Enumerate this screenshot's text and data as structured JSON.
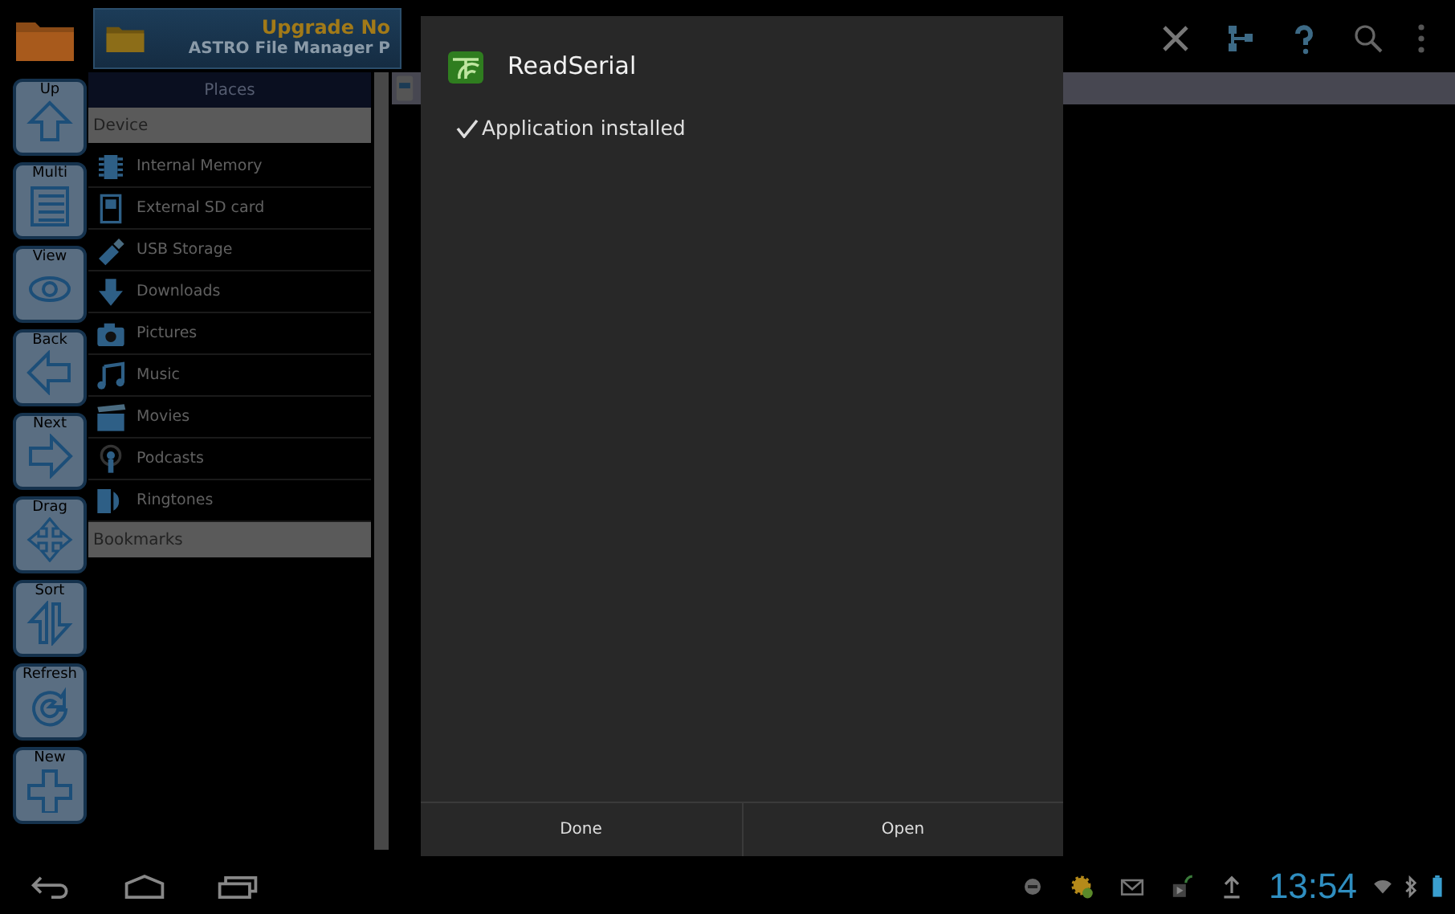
{
  "banner": {
    "headline": "Upgrade No",
    "subtitle": "ASTRO File Manager P"
  },
  "toolbox": [
    {
      "label": "Up",
      "kind": "up"
    },
    {
      "label": "Multi",
      "kind": "multi"
    },
    {
      "label": "View",
      "kind": "view"
    },
    {
      "label": "Back",
      "kind": "back"
    },
    {
      "label": "Next",
      "kind": "next"
    },
    {
      "label": "Drag",
      "kind": "drag"
    },
    {
      "label": "Sort",
      "kind": "sort"
    },
    {
      "label": "Refresh",
      "kind": "refresh"
    },
    {
      "label": "New",
      "kind": "new"
    }
  ],
  "places": {
    "title": "Places",
    "sections": [
      {
        "label": "Device",
        "items": [
          {
            "label": "Internal Memory",
            "kind": "chip"
          },
          {
            "label": "External SD card",
            "kind": "sdcard"
          },
          {
            "label": "USB Storage",
            "kind": "usb"
          },
          {
            "label": "Downloads",
            "kind": "download"
          },
          {
            "label": "Pictures",
            "kind": "camera"
          },
          {
            "label": "Music",
            "kind": "music"
          },
          {
            "label": "Movies",
            "kind": "clapper"
          },
          {
            "label": "Podcasts",
            "kind": "podcast"
          },
          {
            "label": "Ringtones",
            "kind": "ringtone"
          }
        ]
      },
      {
        "label": "Bookmarks"
      }
    ]
  },
  "dialog": {
    "title": "ReadSerial",
    "message": "Application installed",
    "buttons": [
      "Done",
      "Open"
    ]
  },
  "status_bar": {
    "time": "13:54"
  }
}
